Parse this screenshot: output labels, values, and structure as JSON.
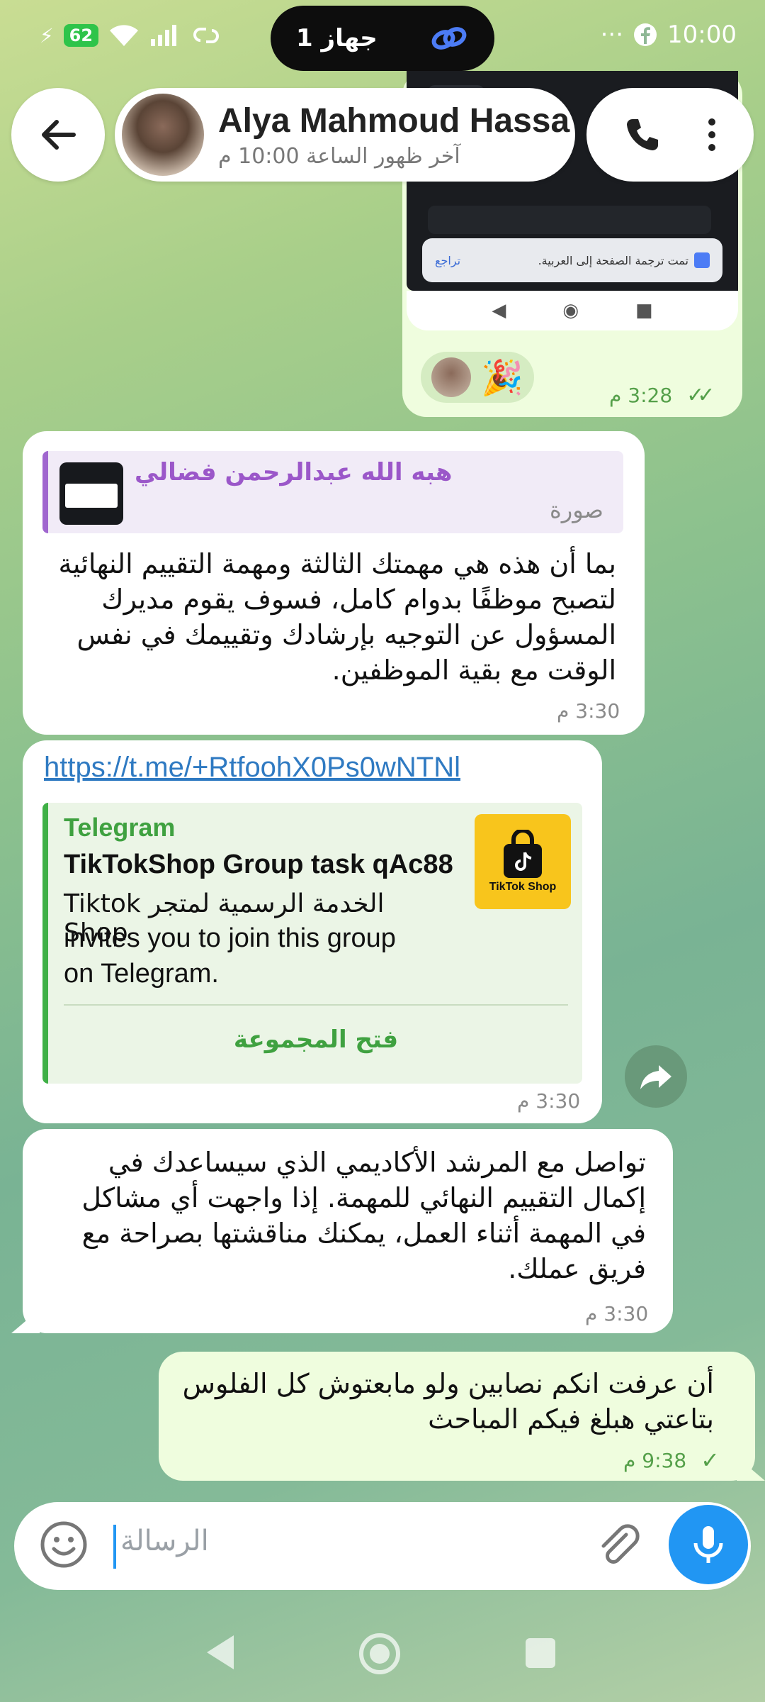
{
  "status_bar": {
    "battery": "62",
    "time": "10:00",
    "dots": "···",
    "device_pill_text": "1 جهاز"
  },
  "header": {
    "contact_name": "Alya Mahmoud Hassa",
    "last_seen": "آخر ظهور الساعة 10:00 م"
  },
  "messages": {
    "image_message": {
      "translate_text": "تمت ترجمة الصفحة إلى العربية.",
      "translate_undo": "تراجع",
      "reaction_emoji": "🎉",
      "time": "3:28 م",
      "check": "✓✓"
    },
    "reply_message": {
      "quote_name": "هبه الله عبدالرحمن فضالي",
      "quote_type": "صورة",
      "text": "بما أن هذه هي مهمتك الثالثة ومهمة التقييم النهائية لتصبح موظفًا بدوام كامل، فسوف يقوم مديرك المسؤول عن التوجيه بإرشادك وتقييمك في نفس الوقت مع بقية الموظفين.",
      "time": "3:30 م"
    },
    "link_message": {
      "url": "https://t.me/+RtfoohX0Ps0wNTNl",
      "site": "Telegram",
      "title": "TikTokShop Group task qAc88",
      "description_line1": "الخدمة الرسمية لمتجر Tiktok Shop",
      "description_line2": "invites you to join this group",
      "description_line3": "on Telegram.",
      "button": "فتح المجموعة",
      "logo_text": "TikTok Shop",
      "time": "3:30 م"
    },
    "advisor_message": {
      "text": "تواصل مع المرشد الأكاديمي الذي سيساعدك في إكمال التقييم النهائي للمهمة. إذا واجهت أي مشاكل في المهمة أثناء العمل، يمكنك مناقشتها بصراحة مع فريق عملك.",
      "time": "3:30 م"
    },
    "outgoing_message": {
      "text": "أن عرفت انكم نصابين ولو مابعتوش كل الفلوس بتاعتي هبلغ فيكم المباحث",
      "time": "9:38 م",
      "check": "✓"
    }
  },
  "input": {
    "placeholder": "الرسالة"
  },
  "colors": {
    "accent": "#2196f3",
    "outgoing_bubble": "#effdde",
    "quote_bar": "#a066cf",
    "preview_bar": "#3fb046"
  }
}
